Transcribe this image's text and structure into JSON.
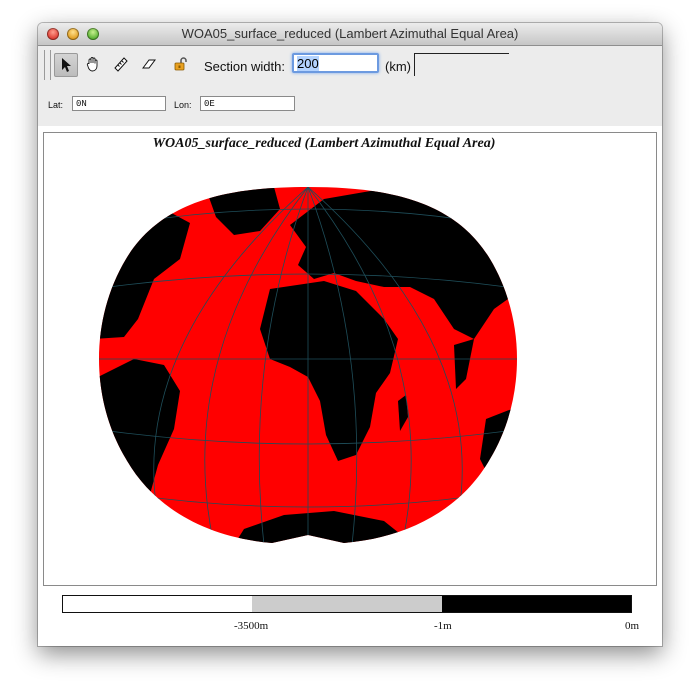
{
  "window": {
    "title": "WOA05_surface_reduced (Lambert Azimuthal Equal Area)"
  },
  "toolbar": {
    "tools": [
      "pointer-icon",
      "hand-pan-icon",
      "ruler-icon",
      "eraser-icon",
      "unlock-icon"
    ],
    "section_width_label": "Section width:",
    "section_width_value": "200",
    "km_label": "(km)"
  },
  "coords": {
    "lat_label": "Lat:",
    "lat_value": "0N",
    "lon_label": "Lon:",
    "lon_value": "0E"
  },
  "map": {
    "title": "WOA05_surface_reduced (Lambert Azimuthal Equal Area)",
    "ocean_color": "#ff0000",
    "land_color": "#000000",
    "graticule_color": "#1e4e5a"
  },
  "colorbar": {
    "segments": [
      "#ffffff",
      "#cccccc",
      "#000000"
    ],
    "labels": [
      "-3500m",
      "-1m",
      "0m"
    ]
  }
}
